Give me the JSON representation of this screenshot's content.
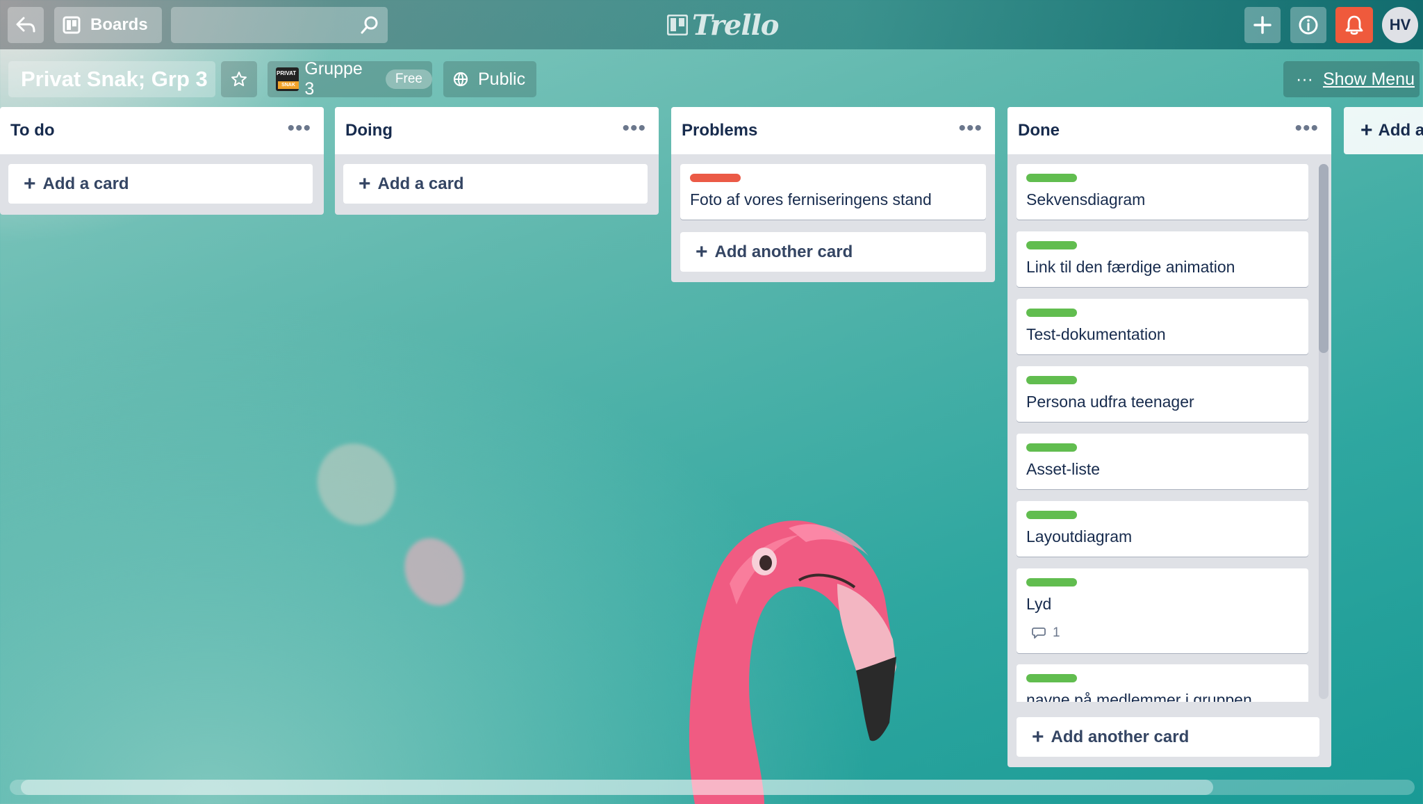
{
  "header": {
    "boards_label": "Boards",
    "search_value": "",
    "logo_text": "Trello",
    "avatar_initials": "HV",
    "icons": [
      "back-icon",
      "boards-icon",
      "search-icon",
      "plus-icon",
      "info-icon",
      "bell-icon"
    ]
  },
  "board": {
    "title": "Privat Snak; Grp 3",
    "team_name": "Gruppe 3",
    "team_plan": "Free",
    "team_logo_top": "PRIVAT",
    "team_logo_bottom": "SNAK",
    "visibility": "Public",
    "show_menu_label": "Show Menu",
    "menu_dots": "···",
    "add_list_label": "Add a"
  },
  "lists": [
    {
      "title": "To do",
      "menu": "•••",
      "cards": [],
      "add_label": "Add a card"
    },
    {
      "title": "Doing",
      "menu": "•••",
      "cards": [],
      "add_label": "Add a card"
    },
    {
      "title": "Problems",
      "menu": "•••",
      "cards": [
        {
          "label_color": "#eb5a46",
          "text": "Foto af vores ferniseringens stand"
        }
      ],
      "add_label": "Add another card"
    },
    {
      "title": "Done",
      "menu": "•••",
      "cards": [
        {
          "label_color": "#61bd4f",
          "text": "Sekvensdiagram"
        },
        {
          "label_color": "#61bd4f",
          "text": "Link til den færdige animation"
        },
        {
          "label_color": "#61bd4f",
          "text": "Test-dokumentation"
        },
        {
          "label_color": "#61bd4f",
          "text": "Persona udfra teenager"
        },
        {
          "label_color": "#61bd4f",
          "text": "Asset-liste"
        },
        {
          "label_color": "#61bd4f",
          "text": "Layoutdiagram"
        },
        {
          "label_color": "#61bd4f",
          "text": "Lyd",
          "comments": "1"
        },
        {
          "label_color": "#61bd4f",
          "text": "navne på medlemmer i gruppen"
        }
      ],
      "add_label": "Add another card"
    }
  ],
  "colors": {
    "label_green": "#61bd4f",
    "label_red": "#eb5a46",
    "notification": "#ef5a3c"
  }
}
